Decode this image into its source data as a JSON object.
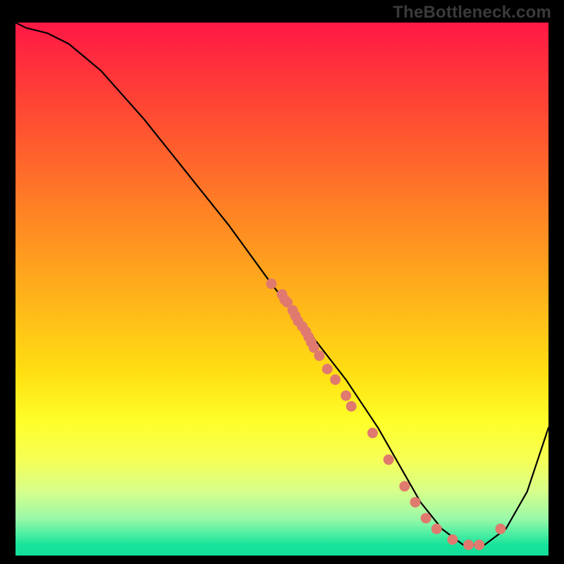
{
  "brand": "TheBottleneck.com",
  "chart_data": {
    "type": "line",
    "title": "",
    "xlabel": "",
    "ylabel": "",
    "xlim": [
      0,
      100
    ],
    "ylim": [
      0,
      100
    ],
    "series": [
      {
        "name": "curve",
        "x": [
          0,
          2,
          6,
          10,
          16,
          24,
          32,
          40,
          48,
          55,
          62,
          68,
          72,
          76,
          80,
          84,
          88,
          92,
          96,
          100
        ],
        "y": [
          100,
          99,
          98,
          96,
          91,
          82,
          72,
          62,
          51,
          42,
          33,
          24,
          17,
          10,
          5,
          2,
          2,
          5,
          12,
          24
        ]
      }
    ],
    "scatter": {
      "name": "points",
      "color": "#e07a6e",
      "x": [
        48,
        50,
        50.5,
        51,
        52,
        52.5,
        53,
        53.8,
        54.5,
        55,
        55.5,
        56,
        57,
        58.5,
        60,
        62,
        63,
        67,
        70,
        73,
        75,
        77,
        79,
        82,
        85,
        87,
        91
      ],
      "y": [
        51,
        49,
        48,
        47.5,
        46,
        45,
        44,
        43,
        42,
        41,
        40,
        39,
        37.5,
        35,
        33,
        30,
        28,
        23,
        18,
        13,
        10,
        7,
        5,
        3,
        2,
        2,
        5
      ]
    }
  }
}
